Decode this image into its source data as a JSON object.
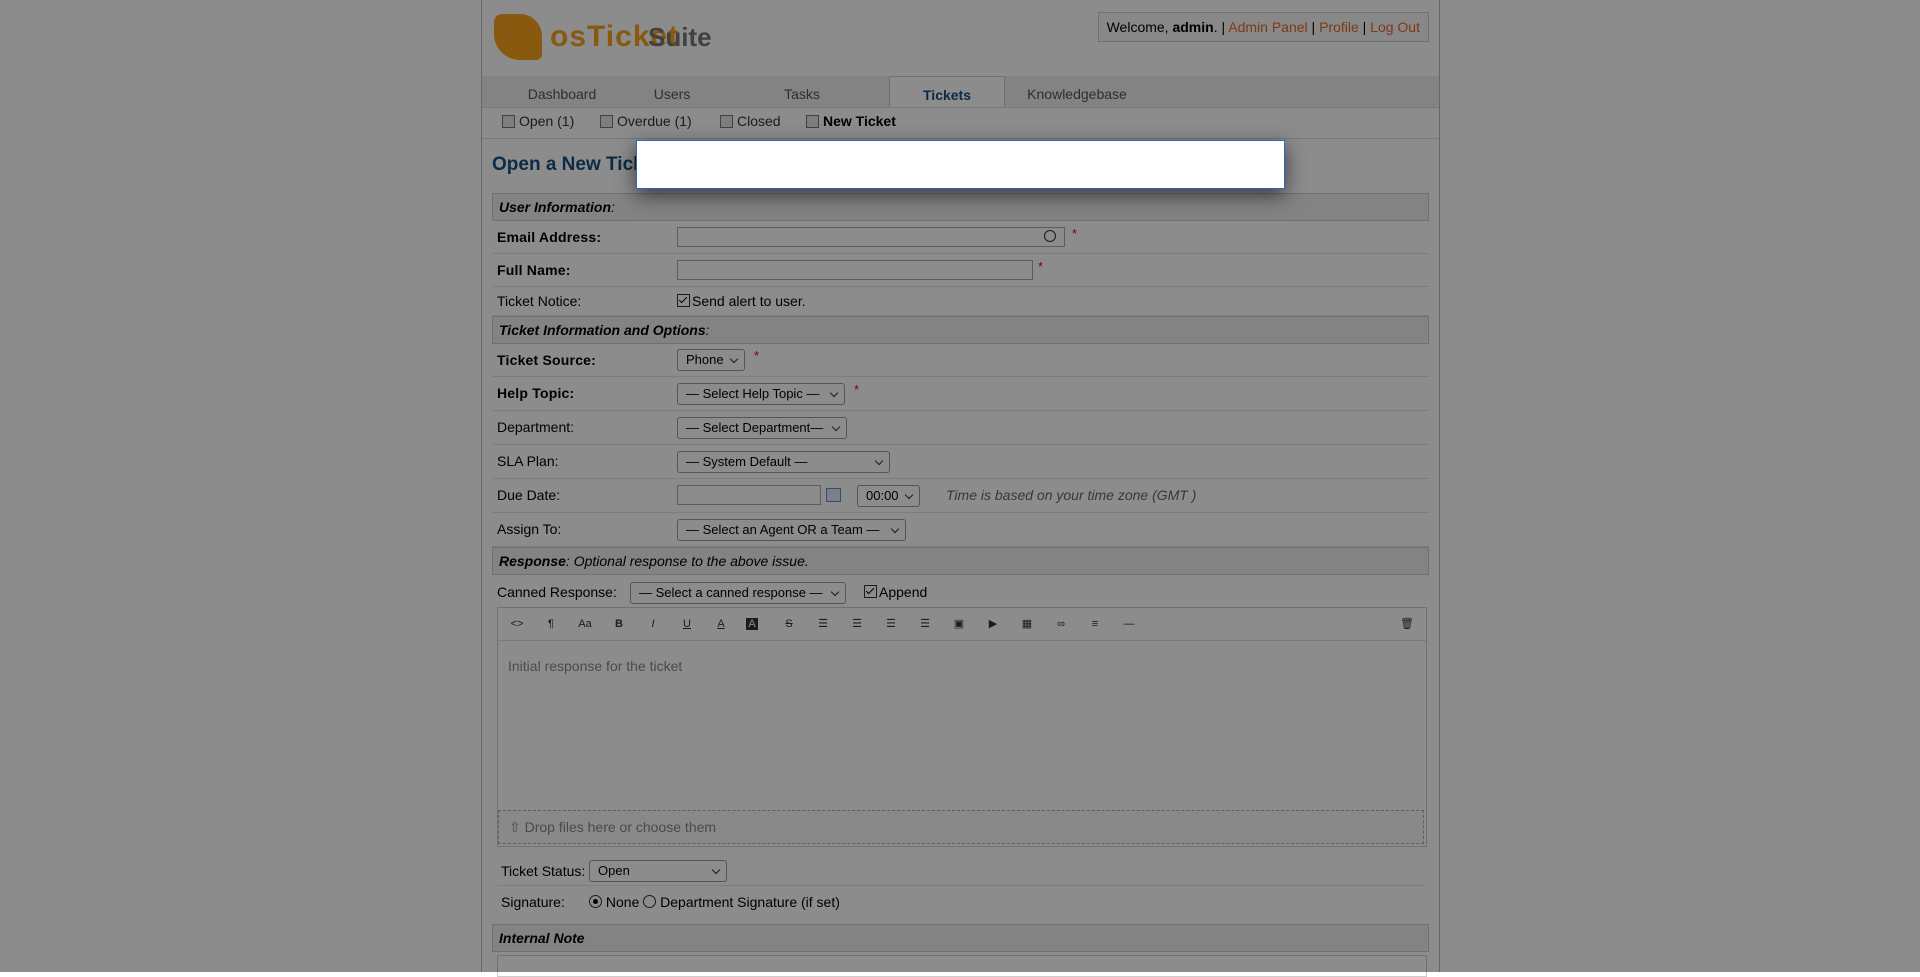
{
  "header": {
    "welcome_prefix": "Welcome, ",
    "username": "admin",
    "admin_panel": "Admin Panel",
    "profile": "Profile",
    "logout": "Log Out",
    "sep": " | "
  },
  "nav": {
    "tabs": [
      {
        "label": "Dashboard"
      },
      {
        "label": "Users"
      },
      {
        "label": "Tasks"
      },
      {
        "label": "Tickets"
      },
      {
        "label": "Knowledgebase"
      }
    ]
  },
  "subnav": {
    "open": "Open (1)",
    "overdue": "Overdue (1)",
    "closed": "Closed",
    "new_ticket": "New Ticket"
  },
  "page": {
    "title": "Open a New Ticket"
  },
  "form": {
    "user_info_section": "User Information",
    "email_label": "Email Address:",
    "fullname_label": "Full Name:",
    "notice_label": "Ticket Notice:",
    "notice_checkbox": "Send alert to user.",
    "ticket_info_section": "Ticket Information and Options",
    "source_label": "Ticket Source:",
    "source_value": "Phone",
    "topic_label": "Help Topic:",
    "topic_value": "— Select Help Topic —",
    "dept_label": "Department:",
    "dept_value": "— Select Department—",
    "sla_label": "SLA Plan:",
    "sla_value": "— System Default —",
    "due_label": "Due Date:",
    "due_time": "00:00",
    "due_note": "Time is based on your time zone (GMT )",
    "assign_label": "Assign To:",
    "assign_value": "— Select an Agent OR a Team —",
    "response_section": "Response",
    "response_section_note": ": Optional response to the above issue.",
    "canned_label": "Canned Response:",
    "canned_value": "— Select a canned response —",
    "append_label": "Append",
    "editor_placeholder": "Initial response for the ticket",
    "drop_text": "Drop files here or choose them",
    "status_label": "Ticket Status:",
    "status_value": "Open",
    "signature_label": "Signature:",
    "sig_none": "None",
    "sig_dept": "Department Signature (if set)",
    "internal_note_section": "Internal Note",
    "required_mark": "*"
  },
  "editor_toolbar": {
    "icons": [
      "code-view-icon",
      "paragraph-format-icon",
      "font-size-icon",
      "bold-icon",
      "italic-icon",
      "underline-icon",
      "font-color-icon",
      "background-color-icon",
      "strikethrough-icon",
      "unordered-list-icon",
      "ordered-list-icon",
      "outdent-icon",
      "indent-icon",
      "insert-image-icon",
      "insert-video-icon",
      "insert-table-icon",
      "insert-link-icon",
      "align-icon",
      "horizontal-rule-icon",
      "clear-icon"
    ]
  },
  "logo": {
    "text_main": "osTicket",
    "text_suffix": "Suite"
  }
}
